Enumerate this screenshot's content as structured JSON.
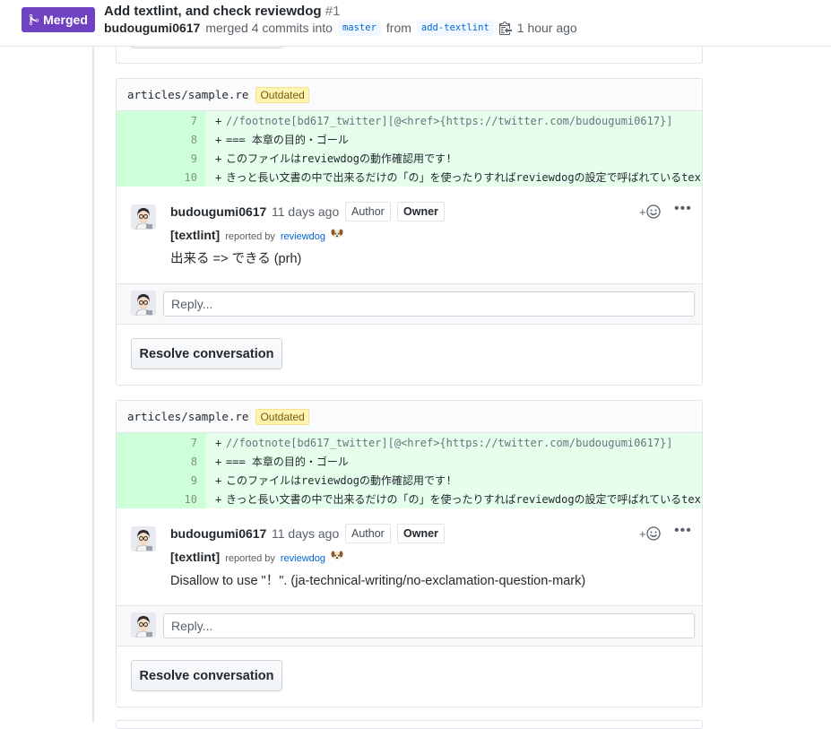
{
  "header": {
    "status_label": "Merged",
    "title": "Add textlint, and check reviewdog",
    "number": "#1",
    "author": "budougumi0617",
    "merged_text": "merged 4 commits into",
    "base_branch": "master",
    "from_text": "from",
    "head_branch": "add-textlint",
    "time": "1 hour ago"
  },
  "threads": [
    {
      "file": "articles/sample.re",
      "outdated_label": "Outdated",
      "diff_lines": [
        {
          "num": "7",
          "sign": "+",
          "text": "//footnote[bd617_twitter][@<href>{https://twitter.com/budougumi0617}]"
        },
        {
          "num": "8",
          "sign": "+",
          "text": "=== 本章の目的・ゴール"
        },
        {
          "num": "9",
          "sign": "+",
          "text": "このファイルはreviewdogの動作確認用です!"
        },
        {
          "num": "10",
          "sign": "+",
          "text": "きっと長い文書の中で出来るだけの「の」を使ったりすればreviewdogの設定で呼ばれているtexlintの"
        }
      ],
      "comment": {
        "author": "budougumi0617",
        "time": "11 days ago",
        "author_badge": "Author",
        "owner_badge": "Owner",
        "tag": "[textlint]",
        "reported_by": "reported by",
        "reporter": "reviewdog",
        "body": "出来る => できる (prh)"
      },
      "reply_placeholder": "Reply...",
      "resolve_label": "Resolve conversation"
    },
    {
      "file": "articles/sample.re",
      "outdated_label": "Outdated",
      "diff_lines": [
        {
          "num": "7",
          "sign": "+",
          "text": "//footnote[bd617_twitter][@<href>{https://twitter.com/budougumi0617}]"
        },
        {
          "num": "8",
          "sign": "+",
          "text": "=== 本章の目的・ゴール"
        },
        {
          "num": "9",
          "sign": "+",
          "text": "このファイルはreviewdogの動作確認用です!"
        },
        {
          "num": "10",
          "sign": "+",
          "text": "きっと長い文書の中で出来るだけの「の」を使ったりすればreviewdogの設定で呼ばれているtexlintの"
        }
      ],
      "comment": {
        "author": "budougumi0617",
        "time": "11 days ago",
        "author_badge": "Author",
        "owner_badge": "Owner",
        "tag": "[textlint]",
        "reported_by": "reported by",
        "reporter": "reviewdog",
        "body": "Disallow to use \"！\". (ja-technical-writing/no-exclamation-question-mark)"
      },
      "reply_placeholder": "Reply...",
      "resolve_label": "Resolve conversation"
    }
  ],
  "icons": {
    "merge": "git-merge-icon",
    "copy": "clippy-icon",
    "reaction": "add-reaction-icon",
    "more": "kebab-horizontal-icon",
    "reporter": "dog-face-icon"
  },
  "colors": {
    "merged": "#6f42c1",
    "added_line": "#e6ffed",
    "added_num": "#cdffd8",
    "link": "#0366d6",
    "outdated_bg": "#fff5b1"
  }
}
